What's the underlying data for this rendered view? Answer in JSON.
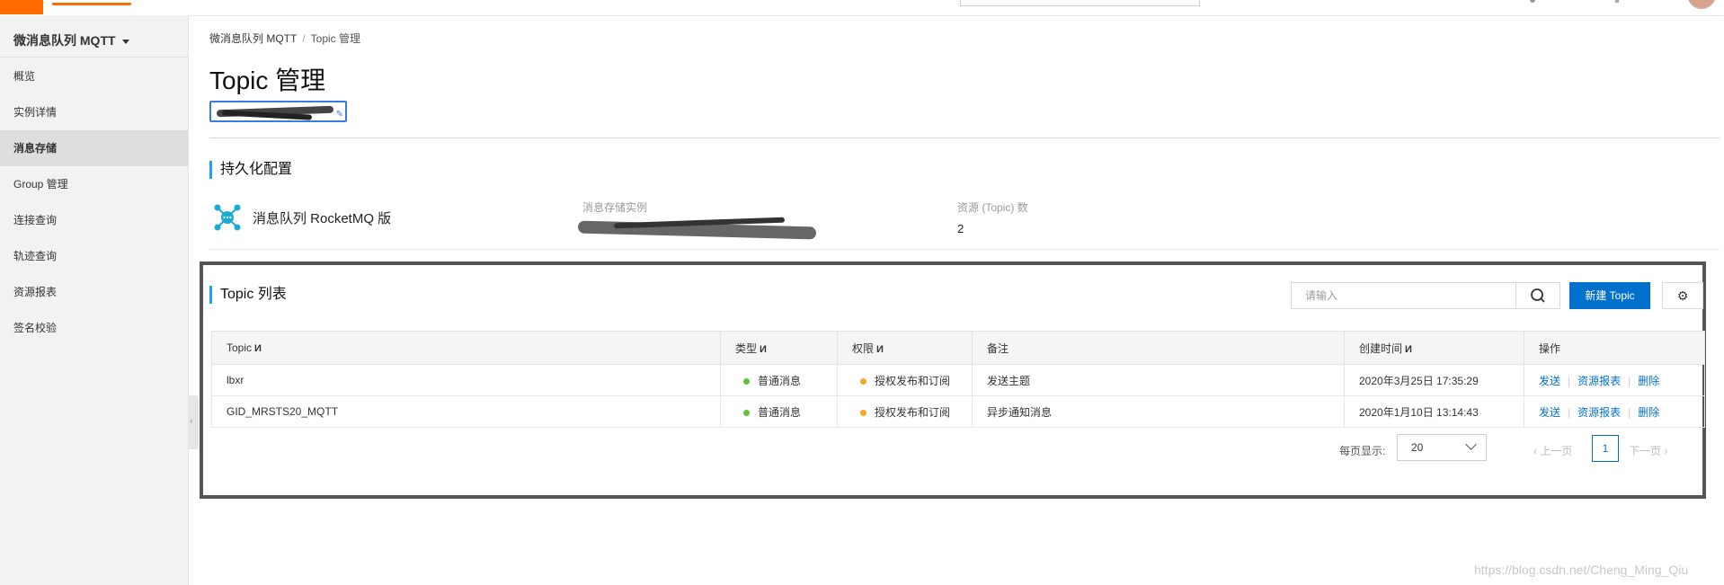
{
  "sidebar": {
    "title": "微消息队列 MQTT",
    "items": [
      {
        "label": "概览"
      },
      {
        "label": "实例详情"
      },
      {
        "label": "消息存储"
      },
      {
        "label": "Group 管理"
      },
      {
        "label": "连接查询"
      },
      {
        "label": "轨迹查询"
      },
      {
        "label": "资源报表"
      },
      {
        "label": "签名校验"
      }
    ],
    "active_index": 2
  },
  "breadcrumb": {
    "root": "微消息队列 MQTT",
    "separator": "/",
    "current": "Topic 管理"
  },
  "page_title": "Topic 管理",
  "persistence": {
    "section_title": "持久化配置",
    "product_name": "消息队列 RocketMQ 版",
    "storage_instance_label": "消息存储实例",
    "resource_count_label": "资源 (Topic) 数",
    "resource_count_value": "2"
  },
  "topic_list": {
    "section_title": "Topic 列表",
    "search_placeholder": "请输入",
    "new_button": "新建 Topic",
    "columns": [
      "Topic",
      "类型",
      "权限",
      "备注",
      "创建时间",
      "操作"
    ],
    "sortable": [
      true,
      true,
      true,
      false,
      true,
      false
    ],
    "rows": [
      {
        "topic": "lbxr",
        "type": "普通消息",
        "permission": "授权发布和订阅",
        "remark": "发送主题",
        "created": "2020年3月25日 17:35:29"
      },
      {
        "topic": "GID_MRSTS20_MQTT",
        "type": "普通消息",
        "permission": "授权发布和订阅",
        "remark": "异步通知消息",
        "created": "2020年1月10日 13:14:43"
      }
    ],
    "actions": [
      "发送",
      "资源报表",
      "删除"
    ],
    "type_dot_color": "#5fc333",
    "permission_dot_color": "#f5a623"
  },
  "pagination": {
    "page_size_label": "每页显示:",
    "page_size": "20",
    "prev": "上一页",
    "current_page": "1",
    "next": "下一页"
  },
  "watermark": "https://blog.csdn.net/Cheng_Ming_Qiu",
  "colors": {
    "brand": "#ff6a00",
    "primary": "#0070cc",
    "accent_bar": "#1ea1ff"
  }
}
